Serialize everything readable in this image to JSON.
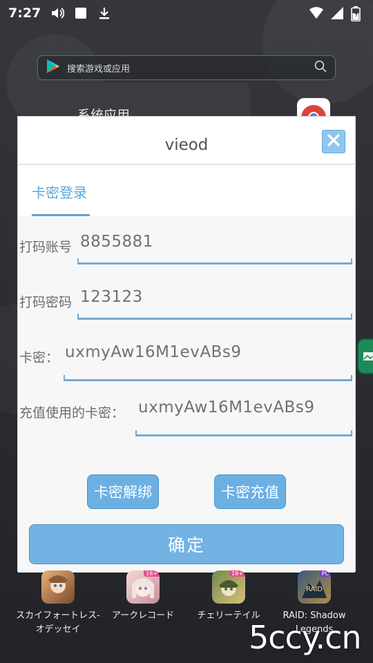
{
  "status_bar": {
    "time": "7:27",
    "left_icons": [
      "volume-icon",
      "stop-icon",
      "download-icon"
    ],
    "right_icons": [
      "wifi-icon",
      "signal-icon",
      "battery-icon"
    ]
  },
  "launcher": {
    "search_placeholder": "搜索游戏或应用",
    "system_apps_label": "系统应用"
  },
  "dialog": {
    "title": "vieod",
    "tab_login": "卡密登录",
    "fields": [
      {
        "label": "打码账号",
        "value": "8855881"
      },
      {
        "label": "打码密码",
        "value": "123123"
      },
      {
        "label": "卡密：",
        "value": "uxmyAw16M1evABs9"
      },
      {
        "label": "充值使用的卡密：",
        "value": "uxmyAw16M1evABs9"
      }
    ],
    "unbind_button": "卡密解绑",
    "recharge_button": "卡密充值",
    "confirm_button": "确定"
  },
  "games": [
    {
      "label": "スカイフォートレス-オデッセイ",
      "icon": "game-icon",
      "colors": [
        "#e8b27a",
        "#7a4a2c"
      ],
      "adult": false
    },
    {
      "label": "アークレコード",
      "icon": "game-icon",
      "colors": [
        "#f4d9d6",
        "#c98e9b"
      ],
      "adult": true
    },
    {
      "label": "チェリーテイル",
      "icon": "game-icon",
      "colors": [
        "#6f8a4e",
        "#d9c07a"
      ],
      "adult": true
    },
    {
      "label": "RAID: Shadow Legends",
      "icon": "game-icon",
      "colors": [
        "#3b5a7a",
        "#b08a4a"
      ],
      "adult": false
    }
  ],
  "game_badge": "18+",
  "game_pc_badge": "PC",
  "watermark": "5ccy.cn",
  "colors": {
    "accent": "#5ba6d8",
    "button": "#6bb0e2"
  }
}
